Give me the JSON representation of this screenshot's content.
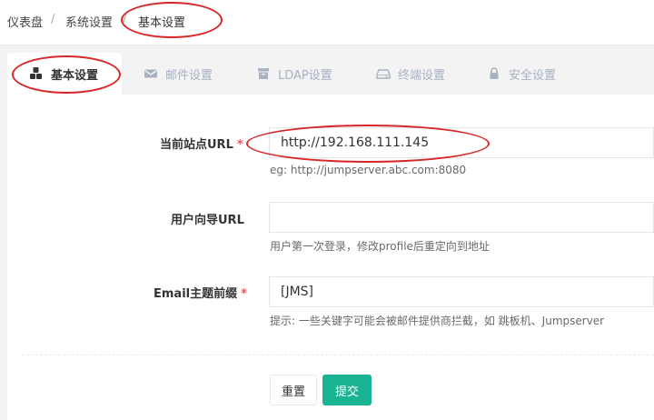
{
  "breadcrumb": {
    "items": [
      "仪表盘",
      "系统设置",
      "基本设置"
    ],
    "separator": "/"
  },
  "tabs": [
    {
      "label": "基本设置",
      "icon": "cubes-icon",
      "active": true
    },
    {
      "label": "邮件设置",
      "icon": "envelope-icon",
      "active": false
    },
    {
      "label": "LDAP设置",
      "icon": "archive-icon",
      "active": false
    },
    {
      "label": "终端设置",
      "icon": "hdd-icon",
      "active": false
    },
    {
      "label": "安全设置",
      "icon": "lock-icon",
      "active": false
    }
  ],
  "form": {
    "site_url": {
      "label": "当前站点URL",
      "required_mark": "*",
      "value": "http://192.168.111.145",
      "help": "eg: http://jumpserver.abc.com:8080"
    },
    "user_guide_url": {
      "label": "用户向导URL",
      "value": "",
      "help": "用户第一次登录，修改profile后重定向到地址"
    },
    "email_prefix": {
      "label": "Email主题前缀",
      "required_mark": "*",
      "value": "[JMS]",
      "help": "提示: 一些关键字可能会被邮件提供商拦截，如 跳板机、Jumpserver"
    },
    "reset_label": "重置",
    "submit_label": "提交"
  },
  "colors": {
    "primary": "#1ab394",
    "required": "#ed5565",
    "annotation": "#d62728"
  }
}
